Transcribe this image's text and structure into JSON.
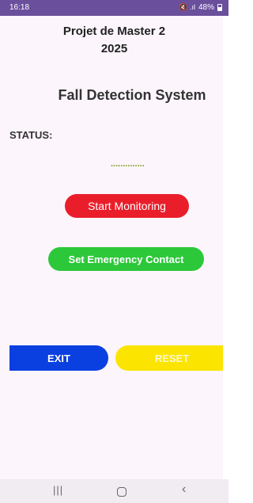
{
  "status_bar": {
    "time": "16:18",
    "icons": "🔇 .ıl",
    "battery": "48%"
  },
  "header": {
    "line1": "Projet de Master 2",
    "line2": "2025"
  },
  "app_title": "Fall Detection System",
  "status": {
    "label": "STATUS:",
    "value": ".............."
  },
  "buttons": {
    "start": "Start Monitoring",
    "contact": "Set Emergency Contact",
    "exit": "EXIT",
    "reset": "RESET"
  },
  "nav": {
    "recent": "|||",
    "back": "‹"
  },
  "colors": {
    "start": "#ea1e2b",
    "contact": "#2cc83a",
    "exit": "#0a3fe0",
    "reset": "#fbe400",
    "status_bar": "#6a4f9c"
  }
}
